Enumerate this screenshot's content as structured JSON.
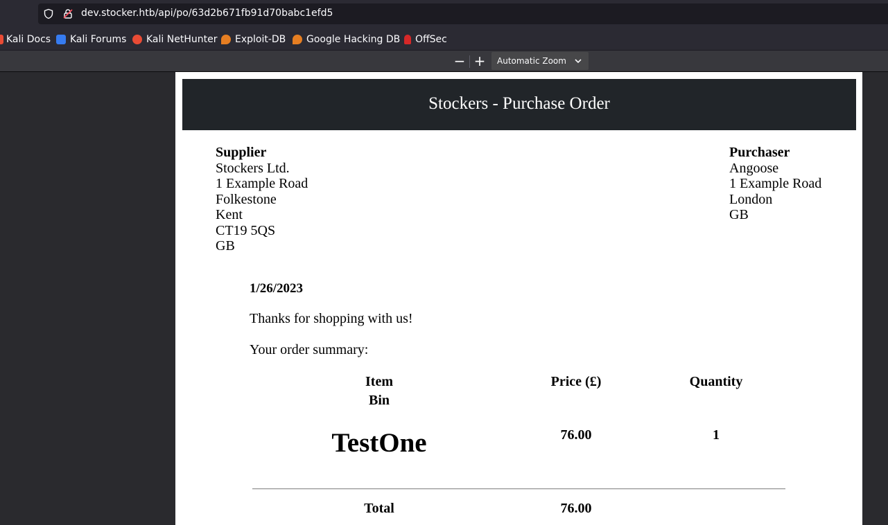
{
  "browser": {
    "url": "dev.stocker.htb/api/po/63d2b671fb91d70babc1efd5",
    "bookmarks": [
      {
        "label": "Kali Docs",
        "icon": "kali-docs-icon"
      },
      {
        "label": "Kali Forums",
        "icon": "kali-forums-icon"
      },
      {
        "label": "Kali NetHunter",
        "icon": "kali-nethunter-icon"
      },
      {
        "label": "Exploit-DB",
        "icon": "exploit-db-icon"
      },
      {
        "label": "Google Hacking DB",
        "icon": "google-hacking-db-icon"
      },
      {
        "label": "OffSec",
        "icon": "offsec-icon"
      }
    ]
  },
  "pdf_toolbar": {
    "zoom_out": "−",
    "zoom_in": "+",
    "zoom_value": "Automatic Zoom"
  },
  "document": {
    "title": "Stockers - Purchase Order",
    "supplier": {
      "heading": "Supplier",
      "lines": [
        "Stockers Ltd.",
        "1 Example Road",
        "Folkestone",
        "Kent",
        "CT19 5QS",
        "GB"
      ]
    },
    "purchaser": {
      "heading": "Purchaser",
      "lines": [
        "Angoose",
        "1 Example Road",
        "London",
        "GB"
      ]
    },
    "date": "1/26/2023",
    "thanks": "Thanks for shopping with us!",
    "summary_label": "Your order summary:",
    "table": {
      "headers": {
        "item": "Item",
        "bin": "Bin",
        "price": "Price (£)",
        "quantity": "Quantity"
      },
      "rows": [
        {
          "item": "TestOne",
          "price": "76.00",
          "quantity": "1"
        }
      ],
      "total_label": "Total",
      "total_value": "76.00"
    }
  },
  "colors": {
    "banner": "#212529",
    "chrome": "#2b2a33",
    "viewer_bg": "#2a2a2e"
  }
}
